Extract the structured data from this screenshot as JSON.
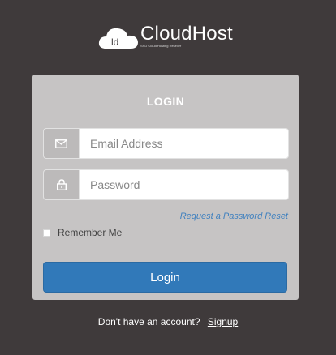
{
  "brand": {
    "logo_mark": "ld",
    "name": "CloudHost",
    "tagline": "SSD Cloud Hosting Reseller"
  },
  "form": {
    "title": "LOGIN",
    "email_placeholder": "Email Address",
    "password_placeholder": "Password",
    "reset_link": "Request a Password Reset",
    "remember_label": "Remember Me",
    "login_button": "Login"
  },
  "footer": {
    "prompt": "Don't have an account?",
    "signup_link": "Signup"
  },
  "colors": {
    "background": "#3f3a3b",
    "panel": "#c6c4c4",
    "accent": "#3179b9",
    "link": "#3f80bf"
  },
  "icons": {
    "email": "envelope-icon",
    "password": "lock-icon",
    "logo": "cloud-icon"
  }
}
